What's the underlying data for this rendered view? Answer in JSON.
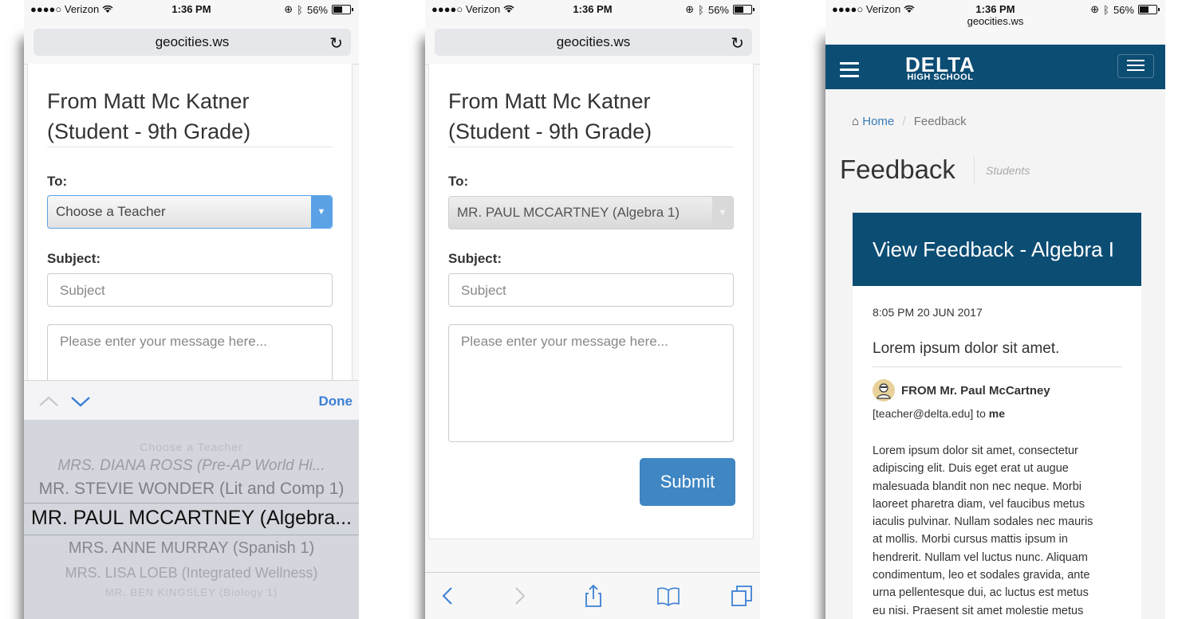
{
  "status": {
    "carrier": "●●●●○ Verizon",
    "time": "1:36 PM",
    "battery": "56%"
  },
  "browser": {
    "domain": "geocities.ws"
  },
  "form": {
    "heading_line1": "From Matt Mc Katner",
    "heading_line2": "(Student - 9th Grade)",
    "to_label": "To:",
    "subject_label": "Subject:",
    "subject_placeholder": "Subject",
    "message_placeholder": "Please enter your message here...",
    "submit_label": "Submit"
  },
  "screen1": {
    "teacher_select_value": "Choose a Teacher",
    "done_label": "Done",
    "picker_options": [
      "Choose a Teacher",
      "MRS. DIANA ROSS (Pre-AP World Hi...",
      "MR. STEVIE WONDER (Lit and Comp 1)",
      "MR. PAUL MCCARTNEY (Algebra...",
      "MRS. ANNE MURRAY (Spanish 1)",
      "MRS. LISA LOEB (Integrated Wellness)",
      "MR. BEN KINGSLEY (Biology 1)"
    ]
  },
  "screen2": {
    "teacher_select_value": "MR. PAUL MCCARTNEY (Algebra 1)"
  },
  "screen3": {
    "logo_top": "DELTA",
    "logo_bottom": "HIGH SCHOOL",
    "breadcrumb_home": "Home",
    "breadcrumb_sep": "/",
    "breadcrumb_current": "Feedback",
    "page_title": "Feedback",
    "page_subtitle": "Students",
    "panel_title": "View Feedback - Algebra I",
    "date": "8:05 PM 20 JUN 2017",
    "subject": "Lorem ipsum dolor sit amet.",
    "from": "FROM Mr. Paul McCartney",
    "email_prefix": "[teacher@delta.edu] to ",
    "email_to": "me",
    "body_lines": [
      "Lorem ipsum dolor sit amet, consectetur",
      "adipiscing elit. Duis eget erat ut augue",
      "malesuada blandit non nec neque. Morbi",
      "laoreet pharetra diam, vel faucibus metus",
      "iaculis pulvinar. Nullam sodales nec mauris",
      "at mollis. Morbi cursus mattis ipsum in",
      "hendrerit. Nullam vel luctus nunc. Aliquam",
      "condimentum, leo et sodales gravida, ante",
      "urna pellentesque dui, ac luctus est metus",
      "eu nisi. Praesent sit amet molestie metus"
    ]
  },
  "colors": {
    "nav_blue": "#0c4d74",
    "button_blue": "#3f86c3",
    "focus_blue": "#5aa1e6",
    "ios_blue": "#3b7fd4"
  }
}
